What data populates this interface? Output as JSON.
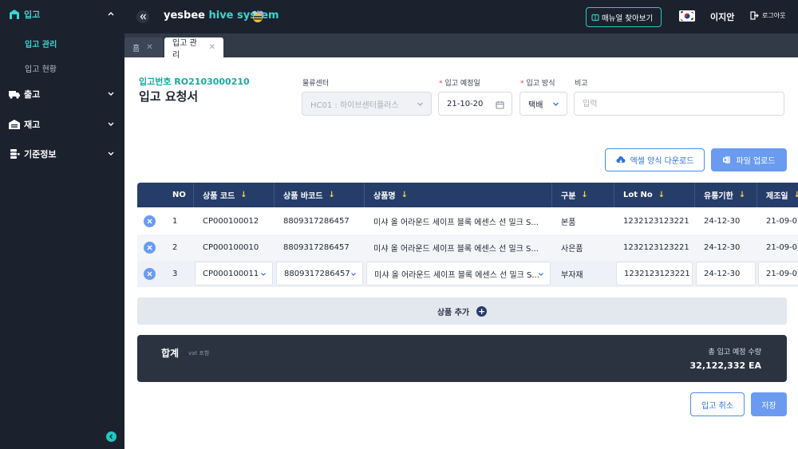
{
  "sidebar": {
    "groups": [
      {
        "label": "입고",
        "icon": "warehouse-icon"
      },
      {
        "label": "출고",
        "icon": "truck-icon"
      },
      {
        "label": "재고",
        "icon": "garage-icon"
      },
      {
        "label": "기준정보",
        "icon": "database-icon"
      }
    ],
    "sub_items": [
      "입고 관리",
      "입고 현황"
    ],
    "accent_color": "#3ad5d0"
  },
  "header": {
    "logo_main": "yesbee",
    "logo_accent": "hive system",
    "manual_button": "매뉴얼 찾아보기",
    "user_name": "이지안",
    "logout": "로그아웃"
  },
  "tabs": [
    {
      "label": "홈"
    },
    {
      "label": "입고 관리"
    }
  ],
  "form": {
    "ref_no": "입고번호 RO2103000210",
    "title": "입고 요청서",
    "center_label": "물류센터",
    "center_value": "HC01 : 하이브센터플러스",
    "date_label": "입고 예정일",
    "date_value": "21-10-20",
    "method_label": "입고 방식",
    "method_value": "택배",
    "note_label": "비고",
    "note_placeholder": "입력",
    "required_mark": "*"
  },
  "buttons": {
    "excel": "엑셀 양식 다운로드",
    "upload": "파일 업로드",
    "add_row": "상품 추가",
    "add_plus": "+",
    "cancel": "입고 취소",
    "save": "저장"
  },
  "table": {
    "columns": [
      "NO",
      "상품 코드",
      "상품 바코드",
      "상품명",
      "구분",
      "Lot No",
      "유통기한",
      "제조일"
    ],
    "sort_arrow": "↓",
    "rows": [
      {
        "no": "1",
        "code": "CP000100012",
        "barcode": "8809317286457",
        "name": "미샤 올 어라운드 세이프 블록 에센스 선 밀크 S...",
        "type": "본품",
        "lot": "1232123123221",
        "expiry": "24-12-30",
        "mfg": "21-09-0"
      },
      {
        "no": "2",
        "code": "CP000100010",
        "barcode": "8809317286457",
        "name": "미샤 올 어라운드 세이프 블록 에센스 선 밀크 S...",
        "type": "사은품",
        "lot": "1232123123221",
        "expiry": "24-12-30",
        "mfg": "21-09-0"
      },
      {
        "no": "3",
        "code": "CP000100011",
        "barcode": "8809317286457",
        "name": "미샤 올 어라운드 세이프 블록 에센스 선 밀크 S...",
        "type": "부자재",
        "lot": "1232123123221",
        "expiry": "24-12-30",
        "mfg": "21-09-0"
      }
    ]
  },
  "summary": {
    "title": "합계",
    "vat": "vat 포함",
    "total_label": "총 입고 예정 수량",
    "total_value": "32,122,332 EA"
  },
  "colors": {
    "navy": "#263d6a",
    "primary": "#6a9bf0",
    "dark": "#1b212d"
  }
}
